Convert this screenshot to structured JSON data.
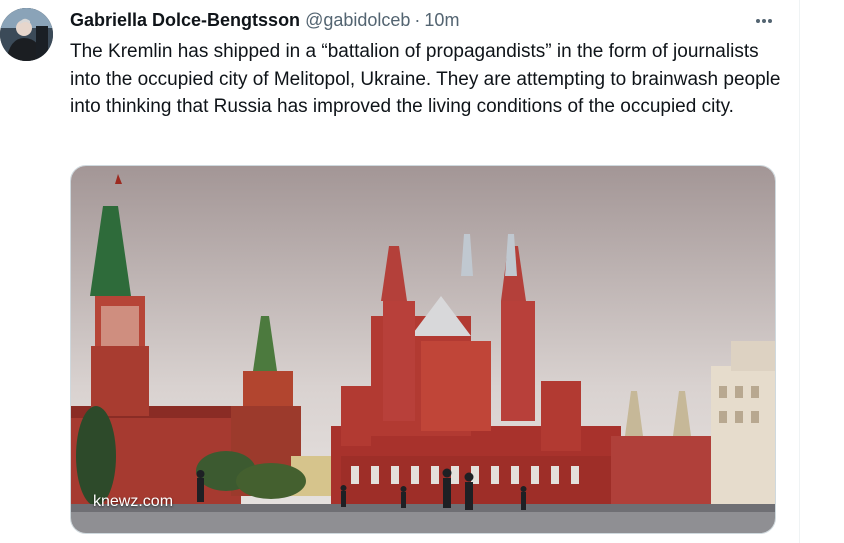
{
  "tweet": {
    "author_name": "Gabriella Dolce-Bengtsson",
    "handle": "@gabidolceb",
    "separator": "·",
    "time": "10m",
    "text": "The Kremlin has shipped in a “battalion of propagandists” in the form of journalists into the occupied city of Melitopol, Ukraine. They are attempting to brainwash people into thinking that Russia has improved the living conditions of the occupied city.",
    "media_watermark": "knewz.com"
  },
  "icons": {
    "more": "more-horizontal-icon"
  },
  "colors": {
    "text": "#0f1419",
    "secondary": "#536471",
    "border": "#cfd9de"
  }
}
